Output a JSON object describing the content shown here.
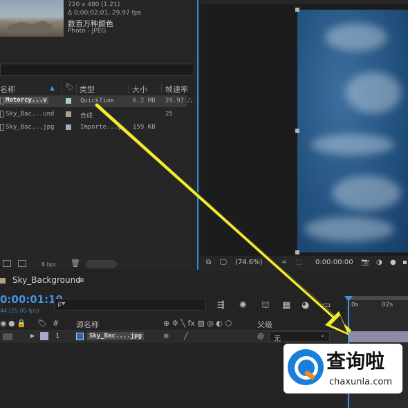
{
  "project": {
    "preview": {
      "dims": "720 x 480 (1.21)",
      "duration": "Δ 0;00;02;01, 29.97 fps",
      "colors": "数百万种颜色",
      "type": "Photo - JPEG"
    },
    "columns": [
      "名称",
      "类型",
      "大小",
      "帧速率"
    ],
    "items": [
      {
        "name": "Motorcy...v",
        "type": "QuickTime",
        "size": "6.2 MB",
        "fps": "29.97",
        "swatch": "#9fd3d1"
      },
      {
        "name": "Sky_Bac...und",
        "type": "合成",
        "size": "",
        "fps": "25",
        "swatch": "#b39f86"
      },
      {
        "name": "Sky_Bac...jpg",
        "type": "Importe...g",
        "size": "159 KB",
        "fps": "",
        "swatch": "#a8a8c9"
      }
    ],
    "footer": {
      "bpc": "8 bpc"
    }
  },
  "viewer": {
    "zoom": "(74.6%)",
    "timecode": "0:00:00:00"
  },
  "timeline": {
    "comp_name": "Sky_Background",
    "timecode": "0:00:01:19",
    "fps_note": "44 (25.00 fps)",
    "search_placeholder": "ρ▾",
    "ruler": [
      "0s",
      "02s"
    ],
    "headers": {
      "num": "#",
      "source_name": "源名称",
      "parent": "父级"
    },
    "layer": {
      "index": "1",
      "name": "Sky_Bac....jpg",
      "parent": "无"
    }
  },
  "watermark": {
    "title": "查询啦",
    "url": "chaxunla.com"
  },
  "colors": {
    "accent": "#2d8ceb",
    "timecode": "#4a90e2",
    "arrow": "#f3ec2c"
  }
}
